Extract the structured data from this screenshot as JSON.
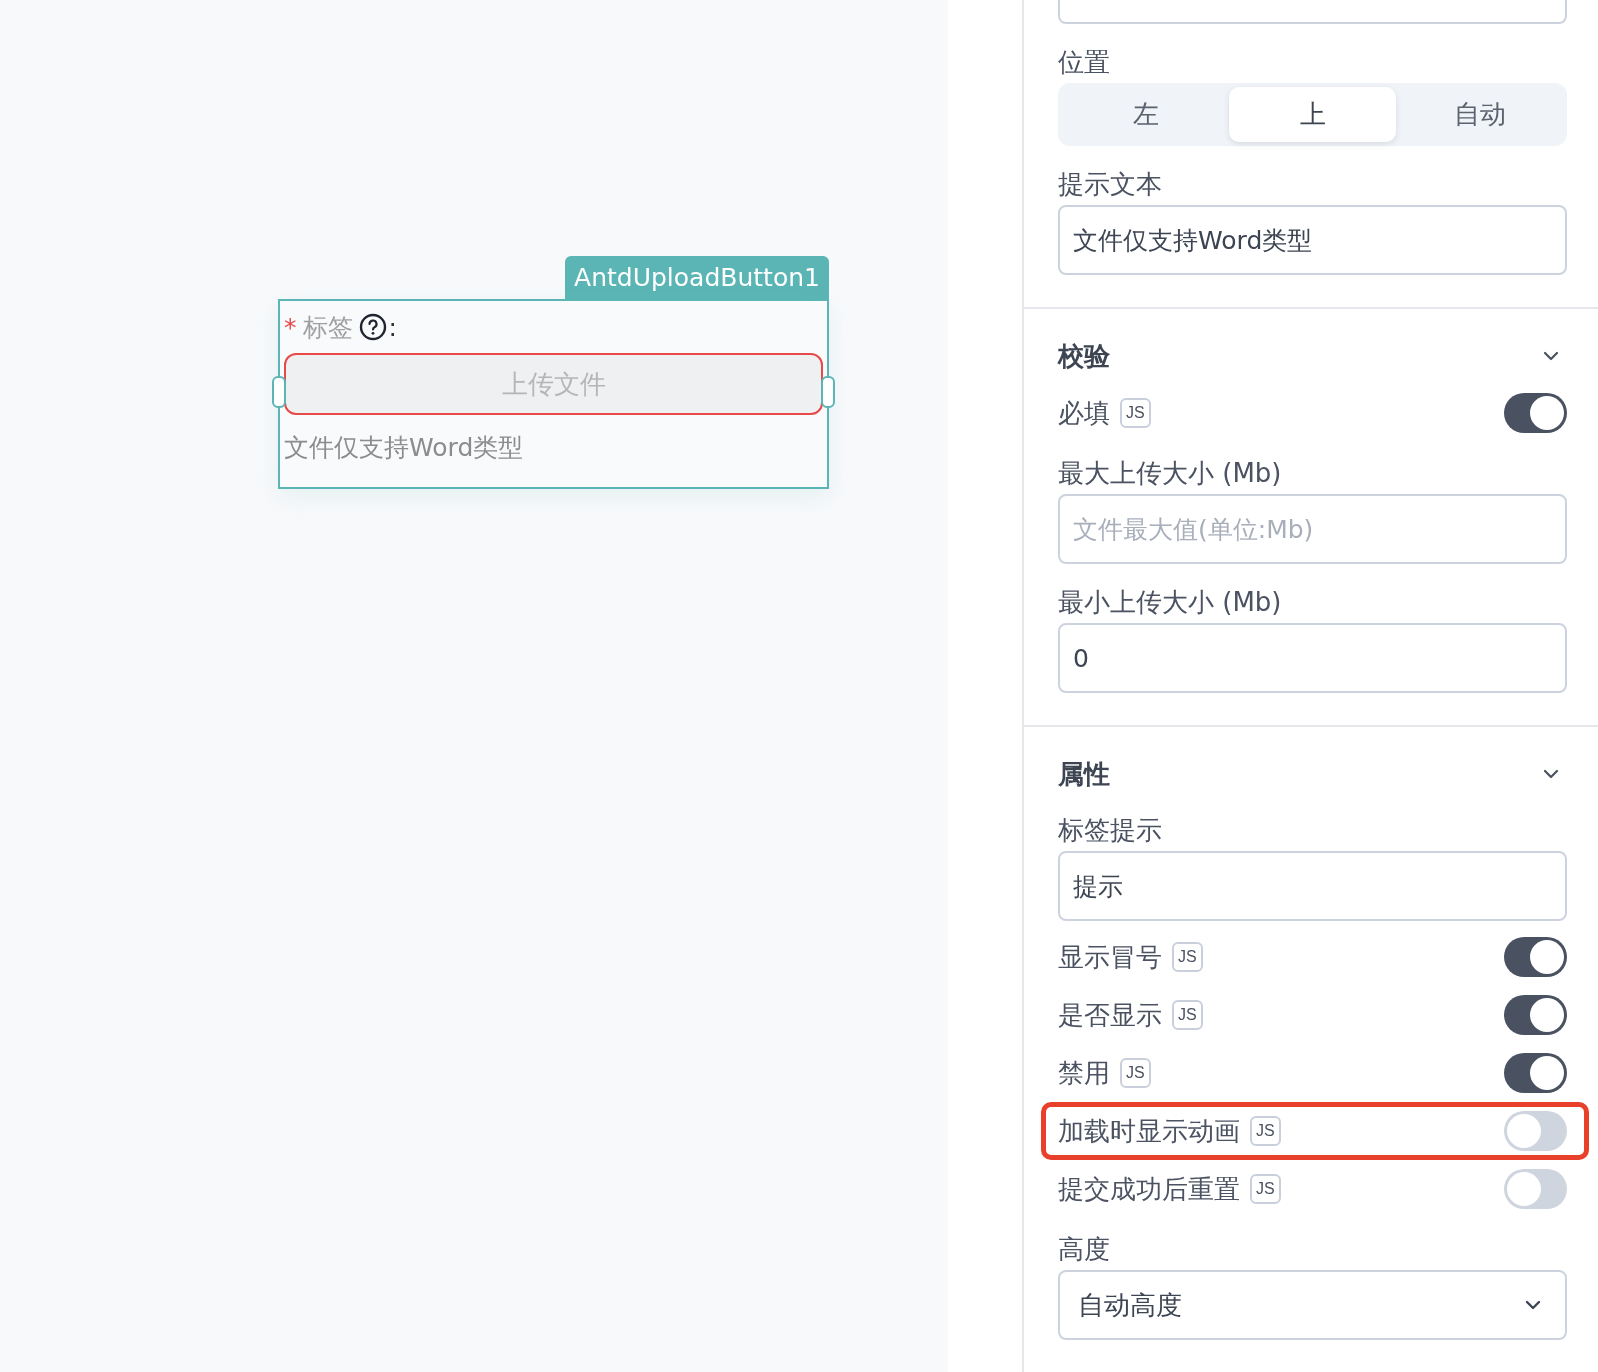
{
  "canvas": {
    "component": {
      "tag": "AntdUploadButton1",
      "required_mark": "*",
      "label": "标签",
      "colon": ":",
      "button": "上传文件",
      "invalid": true,
      "hint": "文件仅支持Word类型"
    }
  },
  "panel": {
    "sections": [
      {
        "items": [
          {
            "kind": "stub"
          },
          {
            "kind": "segmented",
            "label": "位置",
            "options": [
              {
                "label": "左",
                "selected": false
              },
              {
                "label": "上",
                "selected": true
              },
              {
                "label": "自动",
                "selected": false
              }
            ]
          },
          {
            "kind": "field",
            "label": "提示文本",
            "value": "文件仅支持Word类型"
          }
        ]
      },
      {
        "title": "校验",
        "expanded": true,
        "items": [
          {
            "kind": "toggle",
            "label": "必填",
            "badge": "JS",
            "on": true,
            "highlighted": false
          },
          {
            "kind": "field",
            "label": "最大上传大小 (Mb)",
            "placeholder": "文件最大值(单位:Mb)"
          },
          {
            "kind": "field",
            "label": "最小上传大小 (Mb)",
            "value": "0"
          }
        ]
      },
      {
        "title": "属性",
        "expanded": true,
        "items": [
          {
            "kind": "field",
            "label": "标签提示",
            "value": "提示"
          },
          {
            "kind": "toggle",
            "label": "显示冒号",
            "badge": "JS",
            "on": true,
            "highlighted": false
          },
          {
            "kind": "toggle",
            "label": "是否显示",
            "badge": "JS",
            "on": true,
            "highlighted": false
          },
          {
            "kind": "toggle",
            "label": "禁用",
            "badge": "JS",
            "on": true,
            "highlighted": false
          },
          {
            "kind": "toggle",
            "label": "加载时显示动画",
            "badge": "JS",
            "on": false,
            "highlighted": true
          },
          {
            "kind": "toggle",
            "label": "提交成功后重置",
            "badge": "JS",
            "on": false,
            "highlighted": false
          },
          {
            "kind": "select",
            "label": "高度",
            "value": "自动高度"
          }
        ]
      }
    ]
  }
}
